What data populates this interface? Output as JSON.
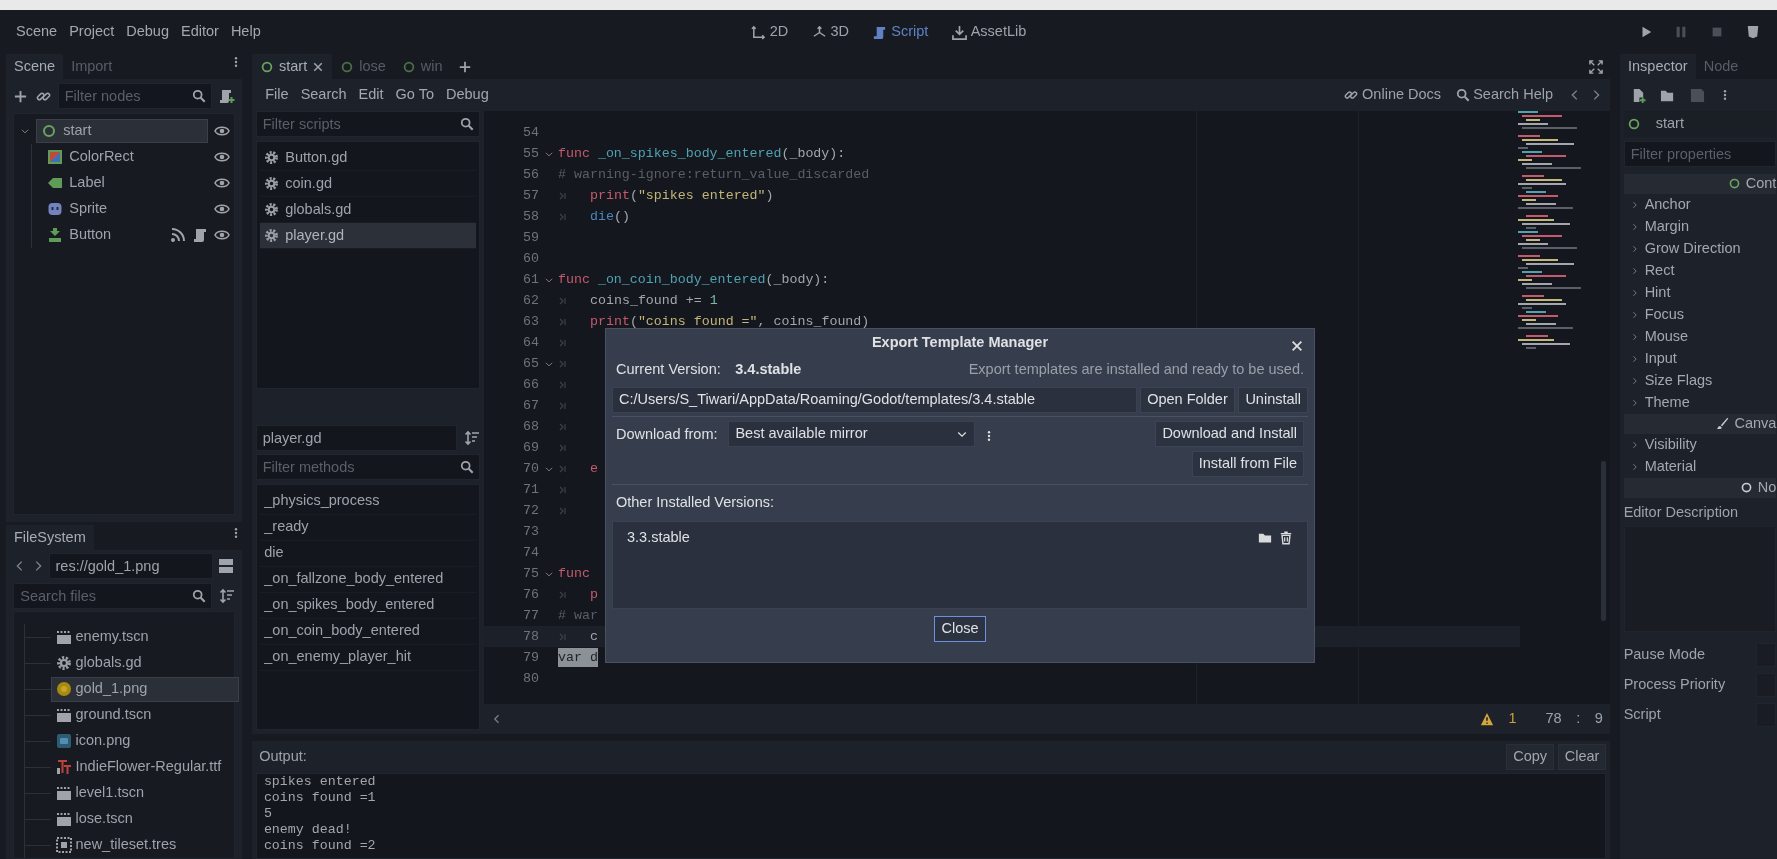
{
  "menu": [
    "Scene",
    "Project",
    "Debug",
    "Editor",
    "Help"
  ],
  "workspaces": [
    {
      "label": "2D",
      "kind": "planar",
      "selected": false
    },
    {
      "label": "3D",
      "kind": "spatial",
      "selected": false
    },
    {
      "label": "Script",
      "kind": "script",
      "selected": true
    },
    {
      "label": "AssetLib",
      "kind": "assetlib",
      "selected": false
    }
  ],
  "scene_dock": {
    "tabs": [
      {
        "label": "Scene",
        "selected": true
      },
      {
        "label": "Import",
        "selected": false
      }
    ],
    "filter_placeholder": "Filter nodes",
    "tree": [
      {
        "label": "start",
        "kind": "control",
        "selected": true,
        "expanded": true,
        "visible": true,
        "signals": false,
        "script": false,
        "children": [
          {
            "label": "ColorRect",
            "kind": "colorrect",
            "selected": false,
            "visible": true,
            "signals": false,
            "script": false
          },
          {
            "label": "Label",
            "kind": "label",
            "selected": false,
            "visible": true,
            "signals": false,
            "script": false
          },
          {
            "label": "Sprite",
            "kind": "sprite",
            "selected": false,
            "visible": true,
            "signals": false,
            "script": false
          },
          {
            "label": "Button",
            "kind": "button",
            "selected": false,
            "visible": true,
            "signals": true,
            "script": true
          }
        ]
      }
    ]
  },
  "filesystem": {
    "tab": "FileSystem",
    "path": "res://gold_1.png",
    "search_placeholder": "Search files",
    "items": [
      {
        "label": "enemy.tscn",
        "kind": "scene",
        "selected": false
      },
      {
        "label": "globals.gd",
        "kind": "script",
        "selected": false
      },
      {
        "label": "gold_1.png",
        "kind": "coin",
        "selected": true
      },
      {
        "label": "ground.tscn",
        "kind": "scene",
        "selected": false
      },
      {
        "label": "icon.png",
        "kind": "image",
        "selected": false
      },
      {
        "label": "IndieFlower-Regular.ttf",
        "kind": "font",
        "selected": false
      },
      {
        "label": "level1.tscn",
        "kind": "scene",
        "selected": false
      },
      {
        "label": "lose.tscn",
        "kind": "scene",
        "selected": false
      },
      {
        "label": "new_tileset.tres",
        "kind": "tileset",
        "selected": false
      }
    ]
  },
  "script_tabs": [
    {
      "label": "start",
      "selected": true
    },
    {
      "label": "lose",
      "selected": false
    },
    {
      "label": "win",
      "selected": false
    }
  ],
  "script_menu": [
    "File",
    "Search",
    "Edit",
    "Go To",
    "Debug"
  ],
  "help_links": [
    {
      "label": "Online Docs",
      "kind": "docs"
    },
    {
      "label": "Search Help",
      "kind": "help"
    }
  ],
  "scripts": {
    "filter_placeholder": "Filter scripts",
    "items": [
      {
        "label": "Button.gd",
        "selected": false
      },
      {
        "label": "coin.gd",
        "selected": false
      },
      {
        "label": "globals.gd",
        "selected": false
      },
      {
        "label": "player.gd",
        "selected": true
      }
    ]
  },
  "methods": {
    "current": "player.gd",
    "filter_placeholder": "Filter methods",
    "items": [
      "_physics_process",
      "_ready",
      "die",
      "_on_fallzone_body_entered",
      "_on_spikes_body_entered",
      "_on_coin_body_entered",
      "_on_enemy_player_hit"
    ]
  },
  "code": [
    {
      "num": "54",
      "fold": false,
      "current": false
    },
    {
      "num": "55",
      "fold": true,
      "current": false,
      "segments": [
        {
          "kind": "kw",
          "text": "func "
        },
        {
          "kind": "fn",
          "text": "_on_spikes_body_entered"
        },
        {
          "kind": "plain",
          "text": "(_body):"
        }
      ]
    },
    {
      "num": "56",
      "fold": false,
      "current": false,
      "segments": [
        {
          "kind": "cm",
          "text": "# warning-ignore:return_value_discarded"
        }
      ]
    },
    {
      "num": "57",
      "fold": false,
      "current": false,
      "segments": [
        {
          "kind": "tab"
        },
        {
          "kind": "kw",
          "text": "print"
        },
        {
          "kind": "plain",
          "text": "("
        },
        {
          "kind": "str",
          "text": "\"spikes entered\""
        },
        {
          "kind": "plain",
          "text": ")"
        }
      ]
    },
    {
      "num": "58",
      "fold": false,
      "current": false,
      "segments": [
        {
          "kind": "tab"
        },
        {
          "kind": "call",
          "text": "die"
        },
        {
          "kind": "plain",
          "text": "()"
        }
      ]
    },
    {
      "num": "59",
      "fold": false,
      "current": false
    },
    {
      "num": "60",
      "fold": false,
      "current": false
    },
    {
      "num": "61",
      "fold": true,
      "current": false,
      "segments": [
        {
          "kind": "kw",
          "text": "func "
        },
        {
          "kind": "fn",
          "text": "_on_coin_body_entered"
        },
        {
          "kind": "plain",
          "text": "(_body):"
        }
      ]
    },
    {
      "num": "62",
      "fold": false,
      "current": false,
      "segments": [
        {
          "kind": "tab"
        },
        {
          "kind": "plain",
          "text": "coins_found += "
        },
        {
          "kind": "num",
          "text": "1"
        }
      ]
    },
    {
      "num": "63",
      "fold": false,
      "current": false,
      "segments": [
        {
          "kind": "tab"
        },
        {
          "kind": "kw",
          "text": "print"
        },
        {
          "kind": "plain",
          "text": "("
        },
        {
          "kind": "str",
          "text": "\"coins found =\""
        },
        {
          "kind": "plain",
          "text": ", coins_found)"
        }
      ]
    },
    {
      "num": "64",
      "fold": false,
      "current": false,
      "segments": [
        {
          "kind": "tab"
        }
      ]
    },
    {
      "num": "65",
      "fold": true,
      "current": false,
      "segments": [
        {
          "kind": "tab"
        }
      ]
    },
    {
      "num": "66",
      "fold": false,
      "current": false,
      "segments": [
        {
          "kind": "tab"
        }
      ]
    },
    {
      "num": "67",
      "fold": false,
      "current": false,
      "segments": [
        {
          "kind": "tab"
        }
      ]
    },
    {
      "num": "68",
      "fold": false,
      "current": false,
      "segments": [
        {
          "kind": "tab"
        }
      ]
    },
    {
      "num": "69",
      "fold": false,
      "current": false,
      "segments": [
        {
          "kind": "tab"
        }
      ]
    },
    {
      "num": "70",
      "fold": true,
      "current": false,
      "segments": [
        {
          "kind": "tab"
        },
        {
          "kind": "kw",
          "text": "e"
        }
      ]
    },
    {
      "num": "71",
      "fold": false,
      "current": false,
      "segments": [
        {
          "kind": "tab"
        }
      ]
    },
    {
      "num": "72",
      "fold": false,
      "current": false,
      "segments": [
        {
          "kind": "tab"
        }
      ]
    },
    {
      "num": "73",
      "fold": false,
      "current": false
    },
    {
      "num": "74",
      "fold": false,
      "current": false
    },
    {
      "num": "75",
      "fold": true,
      "current": false,
      "segments": [
        {
          "kind": "kw",
          "text": "func"
        }
      ]
    },
    {
      "num": "76",
      "fold": false,
      "current": false,
      "segments": [
        {
          "kind": "tab"
        },
        {
          "kind": "kw",
          "text": "p"
        }
      ]
    },
    {
      "num": "77",
      "fold": false,
      "current": false,
      "segments": [
        {
          "kind": "cm",
          "text": "# war"
        }
      ]
    },
    {
      "num": "78",
      "fold": false,
      "current": true,
      "segments": [
        {
          "kind": "tab"
        },
        {
          "kind": "plain",
          "text": "c"
        }
      ]
    },
    {
      "num": "79",
      "fold": false,
      "current": false,
      "segments": [
        {
          "kind": "sel",
          "text": "var d"
        }
      ]
    },
    {
      "num": "80",
      "fold": false,
      "current": false
    }
  ],
  "status": {
    "warnings": "1",
    "line": "78",
    "separator": ":",
    "column": "9"
  },
  "output": {
    "label": "Output:",
    "buttons": [
      "Copy",
      "Clear"
    ],
    "lines": [
      "spikes entered",
      "coins found =1",
      "5",
      "enemy dead!",
      "coins found =2"
    ]
  },
  "inspector": {
    "tabs": [
      {
        "label": "Inspector",
        "selected": true
      },
      {
        "label": "Node",
        "selected": false
      }
    ],
    "object": "start",
    "filter_placeholder": "Filter properties",
    "sections": [
      {
        "title": "Cont",
        "kind": "control",
        "groups": [
          "Anchor",
          "Margin",
          "Grow Direction",
          "Rect",
          "Hint",
          "Focus",
          "Mouse",
          "Input",
          "Size Flags",
          "Theme"
        ]
      },
      {
        "title": "Canva",
        "kind": "canvas",
        "groups": [
          "Visibility",
          "Material"
        ]
      },
      {
        "title": "No",
        "kind": "node"
      }
    ],
    "properties": [
      {
        "label": "Editor Description",
        "kind": "textarea"
      },
      {
        "label": "Pause Mode",
        "kind": "field"
      },
      {
        "label": "Process Priority",
        "kind": "field"
      },
      {
        "label": "Script",
        "kind": "field"
      }
    ]
  },
  "dialog": {
    "title": "Export Template Manager",
    "current_label": "Current Version:",
    "current_version": "3.4.stable",
    "status": "Export templates are installed and ready to be used.",
    "path": "C:/Users/S_Tiwari/AppData/Roaming/Godot/templates/3.4.stable",
    "path_buttons": [
      "Open Folder",
      "Uninstall"
    ],
    "download_label": "Download from:",
    "mirror": "Best available mirror",
    "download_buttons": [
      "Download and Install",
      "Install from File"
    ],
    "other_label": "Other Installed Versions:",
    "other_versions": [
      "3.3.stable"
    ],
    "close": "Close"
  }
}
